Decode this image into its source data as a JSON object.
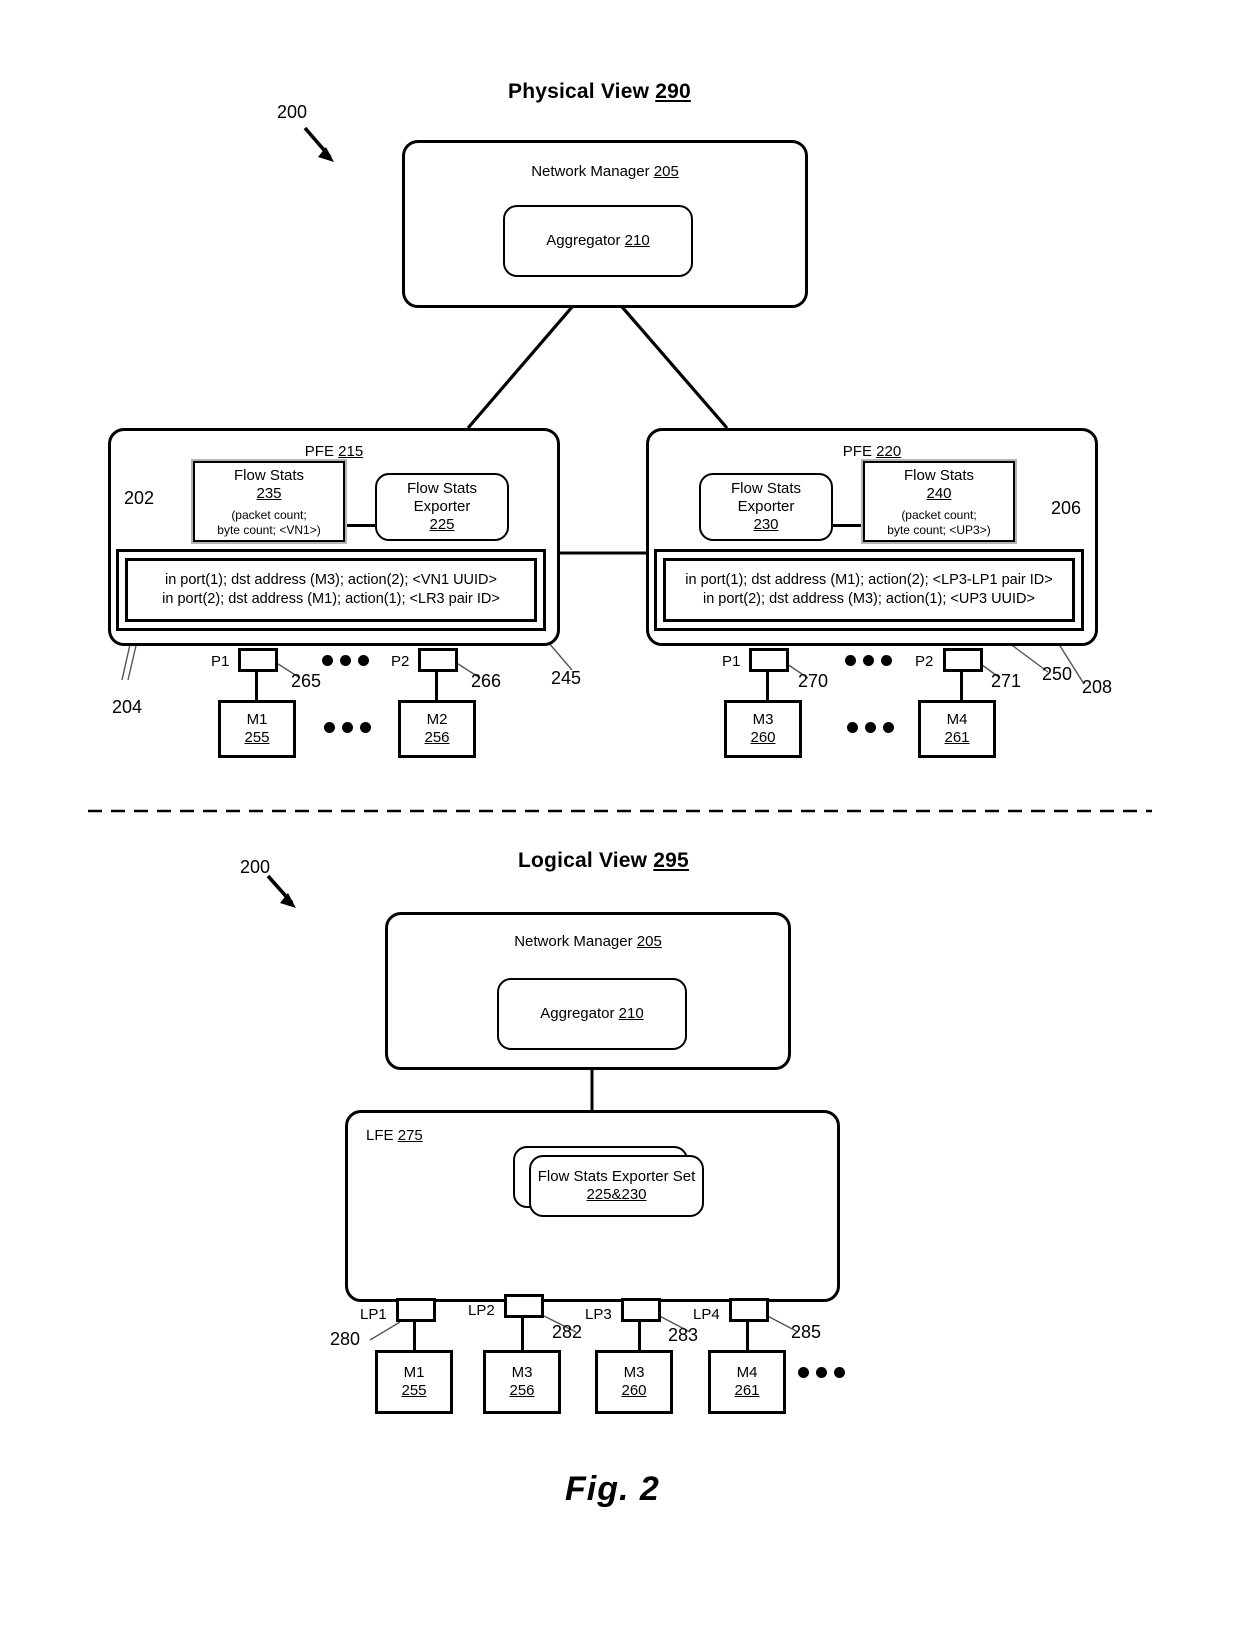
{
  "figure": {
    "caption": "Fig. 2",
    "system_ref_top": "200",
    "system_ref_bottom": "200"
  },
  "physical_view": {
    "title_text": "Physical View",
    "title_ref": "290",
    "network_manager": {
      "label": "Network Manager",
      "ref": "205",
      "aggregator": {
        "label": "Aggregator",
        "ref": "210"
      }
    },
    "pfe_left": {
      "label": "PFE",
      "ref": "215",
      "outer_ref": "202",
      "inner_ref": "204",
      "flow_table_ref": "245",
      "flow_stats": {
        "title": "Flow Stats",
        "ref": "235",
        "note_line1": "(packet count;",
        "note_line2": "byte count; <VN1>)"
      },
      "exporter": {
        "line1": "Flow Stats",
        "line2": "Exporter",
        "ref": "225"
      },
      "flow_rules": [
        "in port(1); dst address (M3); action(2); <VN1 UUID>",
        "in port(2); dst address (M1); action(1); <LR3 pair ID>"
      ],
      "ports": [
        {
          "label": "P1",
          "ref": "265"
        },
        {
          "label": "P2",
          "ref": "266"
        }
      ],
      "vms": [
        {
          "name": "M1",
          "ref": "255"
        },
        {
          "name": "M2",
          "ref": "256"
        }
      ]
    },
    "pfe_right": {
      "label": "PFE",
      "ref": "220",
      "outer_ref": "206",
      "inner_ref": "208",
      "flow_table_ref": "250",
      "flow_stats": {
        "title": "Flow Stats",
        "ref": "240",
        "note_line1": "(packet count;",
        "note_line2": "byte count; <UP3>)"
      },
      "exporter": {
        "line1": "Flow Stats",
        "line2": "Exporter",
        "ref": "230"
      },
      "flow_rules": [
        "in port(1); dst address (M1); action(2); <LP3-LP1 pair ID>",
        "in port(2); dst address (M3); action(1); <UP3 UUID>"
      ],
      "ports": [
        {
          "label": "P1",
          "ref": "270"
        },
        {
          "label": "P2",
          "ref": "271"
        }
      ],
      "vms": [
        {
          "name": "M3",
          "ref": "260"
        },
        {
          "name": "M4",
          "ref": "261"
        }
      ]
    }
  },
  "logical_view": {
    "title_text": "Logical View",
    "title_ref": "295",
    "network_manager": {
      "label": "Network Manager",
      "ref": "205",
      "aggregator": {
        "label": "Aggregator",
        "ref": "210"
      }
    },
    "lfe": {
      "label": "LFE",
      "ref": "275"
    },
    "exporter_set": {
      "title": "Flow Stats Exporter Set",
      "ref": "225&230"
    },
    "logical_ports": [
      {
        "label": "LP1",
        "ref": "280"
      },
      {
        "label": "LP2",
        "ref": "282"
      },
      {
        "label": "LP3",
        "ref": "283"
      },
      {
        "label": "LP4",
        "ref": "285"
      }
    ],
    "vms": [
      {
        "name": "M1",
        "ref": "255"
      },
      {
        "name": "M3",
        "ref": "256"
      },
      {
        "name": "M3",
        "ref": "260"
      },
      {
        "name": "M4",
        "ref": "261"
      }
    ]
  }
}
